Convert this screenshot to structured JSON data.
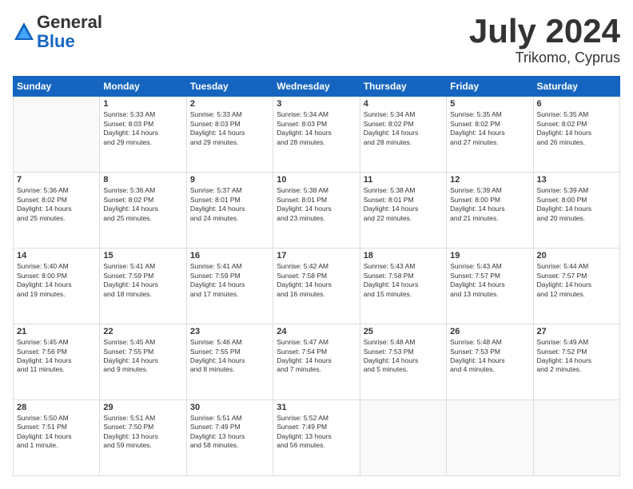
{
  "logo": {
    "general": "General",
    "blue": "Blue"
  },
  "title": "July 2024",
  "location": "Trikomo, Cyprus",
  "days_header": [
    "Sunday",
    "Monday",
    "Tuesday",
    "Wednesday",
    "Thursday",
    "Friday",
    "Saturday"
  ],
  "weeks": [
    [
      {
        "num": "",
        "info": ""
      },
      {
        "num": "1",
        "info": "Sunrise: 5:33 AM\nSunset: 8:03 PM\nDaylight: 14 hours\nand 29 minutes."
      },
      {
        "num": "2",
        "info": "Sunrise: 5:33 AM\nSunset: 8:03 PM\nDaylight: 14 hours\nand 29 minutes."
      },
      {
        "num": "3",
        "info": "Sunrise: 5:34 AM\nSunset: 8:03 PM\nDaylight: 14 hours\nand 28 minutes."
      },
      {
        "num": "4",
        "info": "Sunrise: 5:34 AM\nSunset: 8:02 PM\nDaylight: 14 hours\nand 28 minutes."
      },
      {
        "num": "5",
        "info": "Sunrise: 5:35 AM\nSunset: 8:02 PM\nDaylight: 14 hours\nand 27 minutes."
      },
      {
        "num": "6",
        "info": "Sunrise: 5:35 AM\nSunset: 8:02 PM\nDaylight: 14 hours\nand 26 minutes."
      }
    ],
    [
      {
        "num": "7",
        "info": "Sunrise: 5:36 AM\nSunset: 8:02 PM\nDaylight: 14 hours\nand 25 minutes."
      },
      {
        "num": "8",
        "info": "Sunrise: 5:36 AM\nSunset: 8:02 PM\nDaylight: 14 hours\nand 25 minutes."
      },
      {
        "num": "9",
        "info": "Sunrise: 5:37 AM\nSunset: 8:01 PM\nDaylight: 14 hours\nand 24 minutes."
      },
      {
        "num": "10",
        "info": "Sunrise: 5:38 AM\nSunset: 8:01 PM\nDaylight: 14 hours\nand 23 minutes."
      },
      {
        "num": "11",
        "info": "Sunrise: 5:38 AM\nSunset: 8:01 PM\nDaylight: 14 hours\nand 22 minutes."
      },
      {
        "num": "12",
        "info": "Sunrise: 5:39 AM\nSunset: 8:00 PM\nDaylight: 14 hours\nand 21 minutes."
      },
      {
        "num": "13",
        "info": "Sunrise: 5:39 AM\nSunset: 8:00 PM\nDaylight: 14 hours\nand 20 minutes."
      }
    ],
    [
      {
        "num": "14",
        "info": "Sunrise: 5:40 AM\nSunset: 8:00 PM\nDaylight: 14 hours\nand 19 minutes."
      },
      {
        "num": "15",
        "info": "Sunrise: 5:41 AM\nSunset: 7:59 PM\nDaylight: 14 hours\nand 18 minutes."
      },
      {
        "num": "16",
        "info": "Sunrise: 5:41 AM\nSunset: 7:59 PM\nDaylight: 14 hours\nand 17 minutes."
      },
      {
        "num": "17",
        "info": "Sunrise: 5:42 AM\nSunset: 7:58 PM\nDaylight: 14 hours\nand 16 minutes."
      },
      {
        "num": "18",
        "info": "Sunrise: 5:43 AM\nSunset: 7:58 PM\nDaylight: 14 hours\nand 15 minutes."
      },
      {
        "num": "19",
        "info": "Sunrise: 5:43 AM\nSunset: 7:57 PM\nDaylight: 14 hours\nand 13 minutes."
      },
      {
        "num": "20",
        "info": "Sunrise: 5:44 AM\nSunset: 7:57 PM\nDaylight: 14 hours\nand 12 minutes."
      }
    ],
    [
      {
        "num": "21",
        "info": "Sunrise: 5:45 AM\nSunset: 7:56 PM\nDaylight: 14 hours\nand 11 minutes."
      },
      {
        "num": "22",
        "info": "Sunrise: 5:45 AM\nSunset: 7:55 PM\nDaylight: 14 hours\nand 9 minutes."
      },
      {
        "num": "23",
        "info": "Sunrise: 5:46 AM\nSunset: 7:55 PM\nDaylight: 14 hours\nand 8 minutes."
      },
      {
        "num": "24",
        "info": "Sunrise: 5:47 AM\nSunset: 7:54 PM\nDaylight: 14 hours\nand 7 minutes."
      },
      {
        "num": "25",
        "info": "Sunrise: 5:48 AM\nSunset: 7:53 PM\nDaylight: 14 hours\nand 5 minutes."
      },
      {
        "num": "26",
        "info": "Sunrise: 5:48 AM\nSunset: 7:53 PM\nDaylight: 14 hours\nand 4 minutes."
      },
      {
        "num": "27",
        "info": "Sunrise: 5:49 AM\nSunset: 7:52 PM\nDaylight: 14 hours\nand 2 minutes."
      }
    ],
    [
      {
        "num": "28",
        "info": "Sunrise: 5:50 AM\nSunset: 7:51 PM\nDaylight: 14 hours\nand 1 minute."
      },
      {
        "num": "29",
        "info": "Sunrise: 5:51 AM\nSunset: 7:50 PM\nDaylight: 13 hours\nand 59 minutes."
      },
      {
        "num": "30",
        "info": "Sunrise: 5:51 AM\nSunset: 7:49 PM\nDaylight: 13 hours\nand 58 minutes."
      },
      {
        "num": "31",
        "info": "Sunrise: 5:52 AM\nSunset: 7:49 PM\nDaylight: 13 hours\nand 56 minutes."
      },
      {
        "num": "",
        "info": ""
      },
      {
        "num": "",
        "info": ""
      },
      {
        "num": "",
        "info": ""
      }
    ]
  ]
}
